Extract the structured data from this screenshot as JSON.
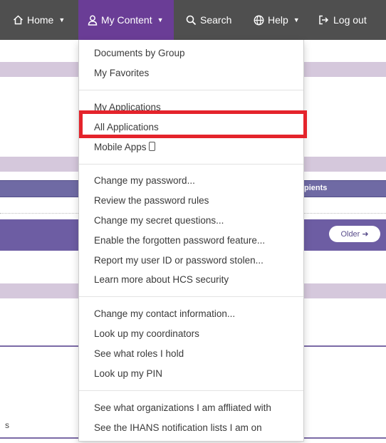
{
  "nav": {
    "home": "Home",
    "my_content": "My Content",
    "search": "Search",
    "help": "Help",
    "logout": "Log out"
  },
  "background": {
    "recipients_fragment": "pients",
    "older_button": "Older",
    "left_fragment": "s"
  },
  "menu": {
    "documents_by_group": "Documents by Group",
    "my_favorites": "My Favorites",
    "my_applications": "My Applications",
    "all_applications": "All Applications",
    "mobile_apps": "Mobile Apps",
    "change_password": "Change my password...",
    "review_password_rules": "Review the password rules",
    "change_secret_questions": "Change my secret questions...",
    "enable_forgotten_password": "Enable the forgotten password feature...",
    "report_stolen": "Report my user ID or password stolen...",
    "learn_security": "Learn more about HCS security",
    "change_contact": "Change my contact information...",
    "look_up_coordinators": "Look up my coordinators",
    "see_roles": "See what roles I hold",
    "look_up_pin": "Look up my PIN",
    "see_organizations": "See what organizations I am affliated with",
    "see_ihans_lists": "See the IHANS notification lists I am on"
  },
  "colors": {
    "navbar": "#4f4f4f",
    "active_nav": "#6a3d96",
    "highlight": "#e4232b"
  }
}
